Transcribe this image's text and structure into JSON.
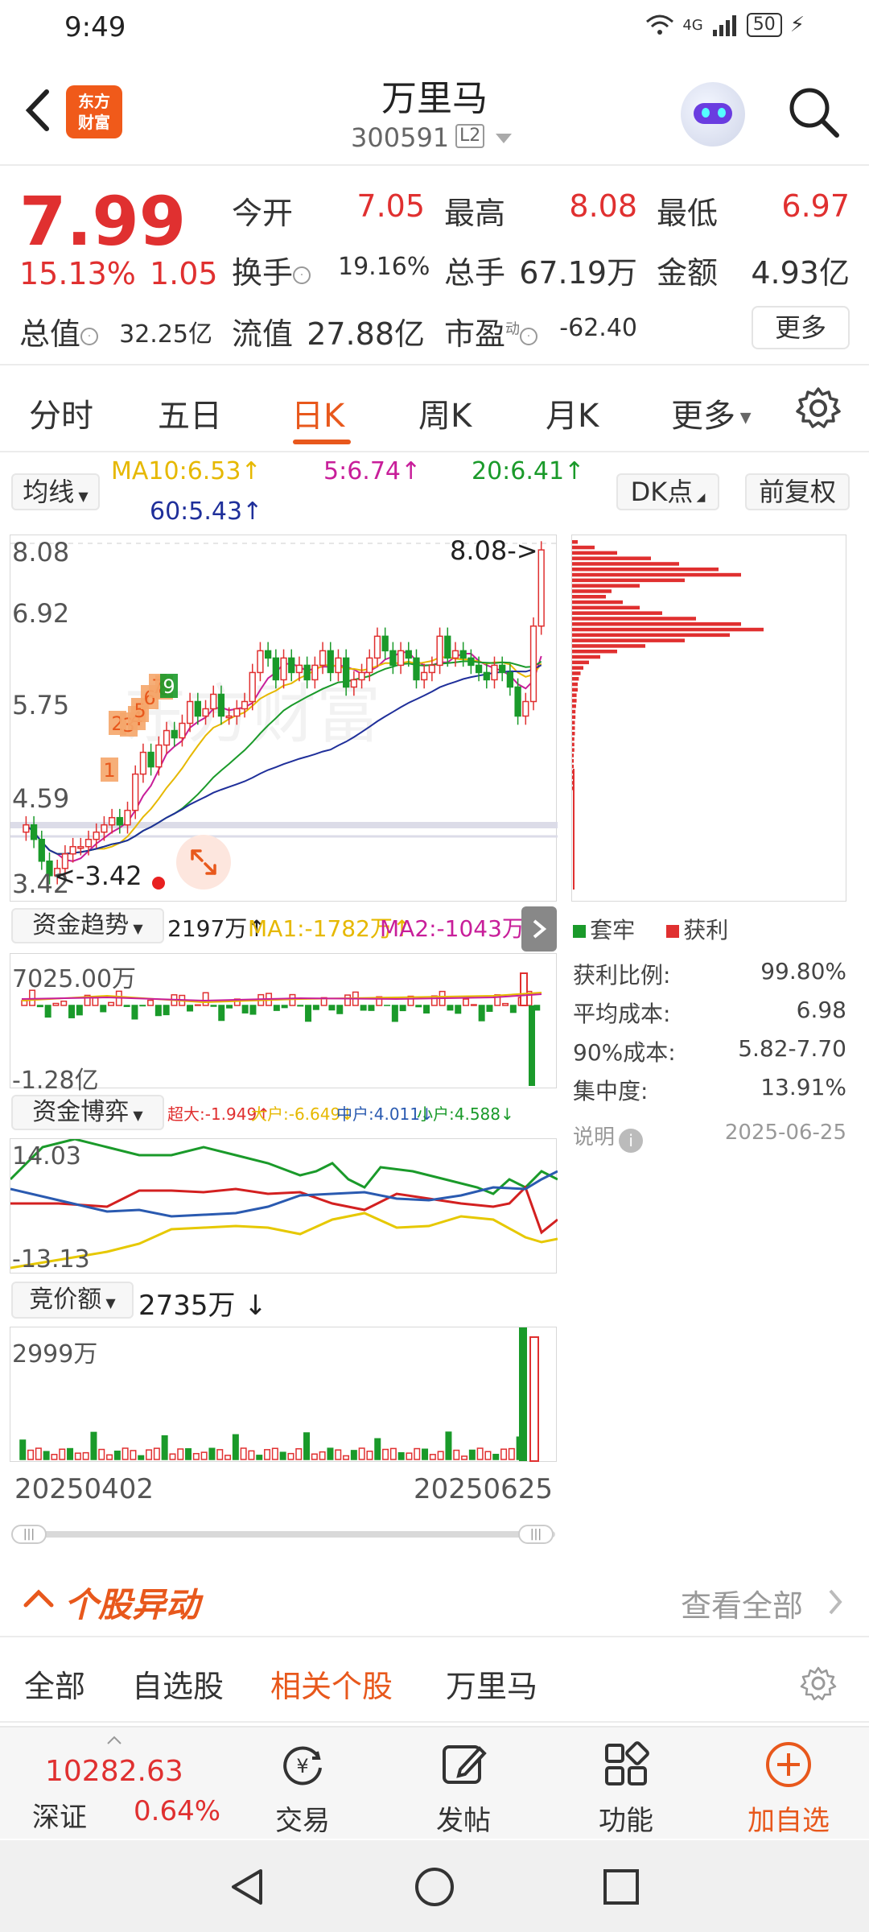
{
  "status": {
    "time": "9:49",
    "network": "4G",
    "battery": "50"
  },
  "header": {
    "logo_text": "东方财富",
    "stock_name": "万里马",
    "stock_code": "300591",
    "level_badge": "L2"
  },
  "quote": {
    "price": "7.99",
    "change_pct": "15.13%",
    "change_abs": "1.05",
    "fields": {
      "open_label": "今开",
      "open": "7.05",
      "high_label": "最高",
      "high": "8.08",
      "low_label": "最低",
      "low": "6.97",
      "turnover_label": "换手",
      "turnover": "19.16%",
      "volume_label": "总手",
      "volume": "67.19万",
      "amount_label": "金额",
      "amount": "4.93亿",
      "mktcap_label": "总值",
      "mktcap": "32.25亿",
      "float_label": "流值",
      "float_cap": "27.88亿",
      "pe_label": "市盈",
      "pe_sup": "动",
      "pe": "-62.40"
    },
    "more_label": "更多"
  },
  "tabs": [
    "分时",
    "五日",
    "日K",
    "周K",
    "月K",
    "更多"
  ],
  "active_tab": "日K",
  "ma_bar": {
    "selector": "均线",
    "ma10": "MA10:6.53↑",
    "ma5": "5:6.74↑",
    "ma20": "20:6.41↑",
    "ma60": "60:5.43↑",
    "dk_button": "DK点",
    "adjust_button": "前复权"
  },
  "kline": {
    "y_labels": [
      "8.08",
      "6.92",
      "5.75",
      "4.59",
      "3.42"
    ],
    "high_marker": "8.08->",
    "low_marker": "<-3.42",
    "dk_points": [
      "1",
      "2",
      "3",
      "4",
      "5",
      "6",
      "7",
      "8",
      "9"
    ],
    "watermark": "东方财富"
  },
  "chip_panel": {
    "legend_trapped": "套牢",
    "legend_profit": "获利",
    "rows": [
      {
        "label": "获利比例:",
        "value": "99.80%"
      },
      {
        "label": "平均成本:",
        "value": "6.98"
      },
      {
        "label": "90%成本:",
        "value": "5.82-7.70"
      },
      {
        "label": "集中度:",
        "value": "13.91%"
      }
    ],
    "note_label": "说明",
    "date": "2025-06-25"
  },
  "fund_trend": {
    "selector": "资金趋势",
    "value": "2197万↑",
    "ma1": "MA1:-1782万↑",
    "ma2": "MA2:-1043万↑",
    "y_top": "7025.00万",
    "y_bottom": "-1.28亿"
  },
  "fund_game": {
    "selector": "资金博弈",
    "super": "超大:-1.949↑",
    "large": "大户:-6.649↓",
    "medium": "中户:4.011↓",
    "small": "小户:4.588↓",
    "y_top": "14.03",
    "y_bottom": "-13.13"
  },
  "auction": {
    "selector": "竞价额",
    "value": "2735万 ↓",
    "y_top": "2999万",
    "date_start": "20250402",
    "date_end": "20250625"
  },
  "anomaly": {
    "title": "个股异动",
    "view_all": "查看全部"
  },
  "subtabs": [
    "全部",
    "自选股",
    "相关个股",
    "万里马"
  ],
  "active_subtab": "相关个股",
  "bottom": {
    "index_value": "10282.63",
    "index_name": "深证",
    "index_pct": "0.64%",
    "trade": "交易",
    "post": "发帖",
    "functions": "功能",
    "add_watch": "加自选"
  },
  "colors": {
    "accent": "#e8581c",
    "up": "#e03030",
    "down": "#1a9a2a"
  }
}
